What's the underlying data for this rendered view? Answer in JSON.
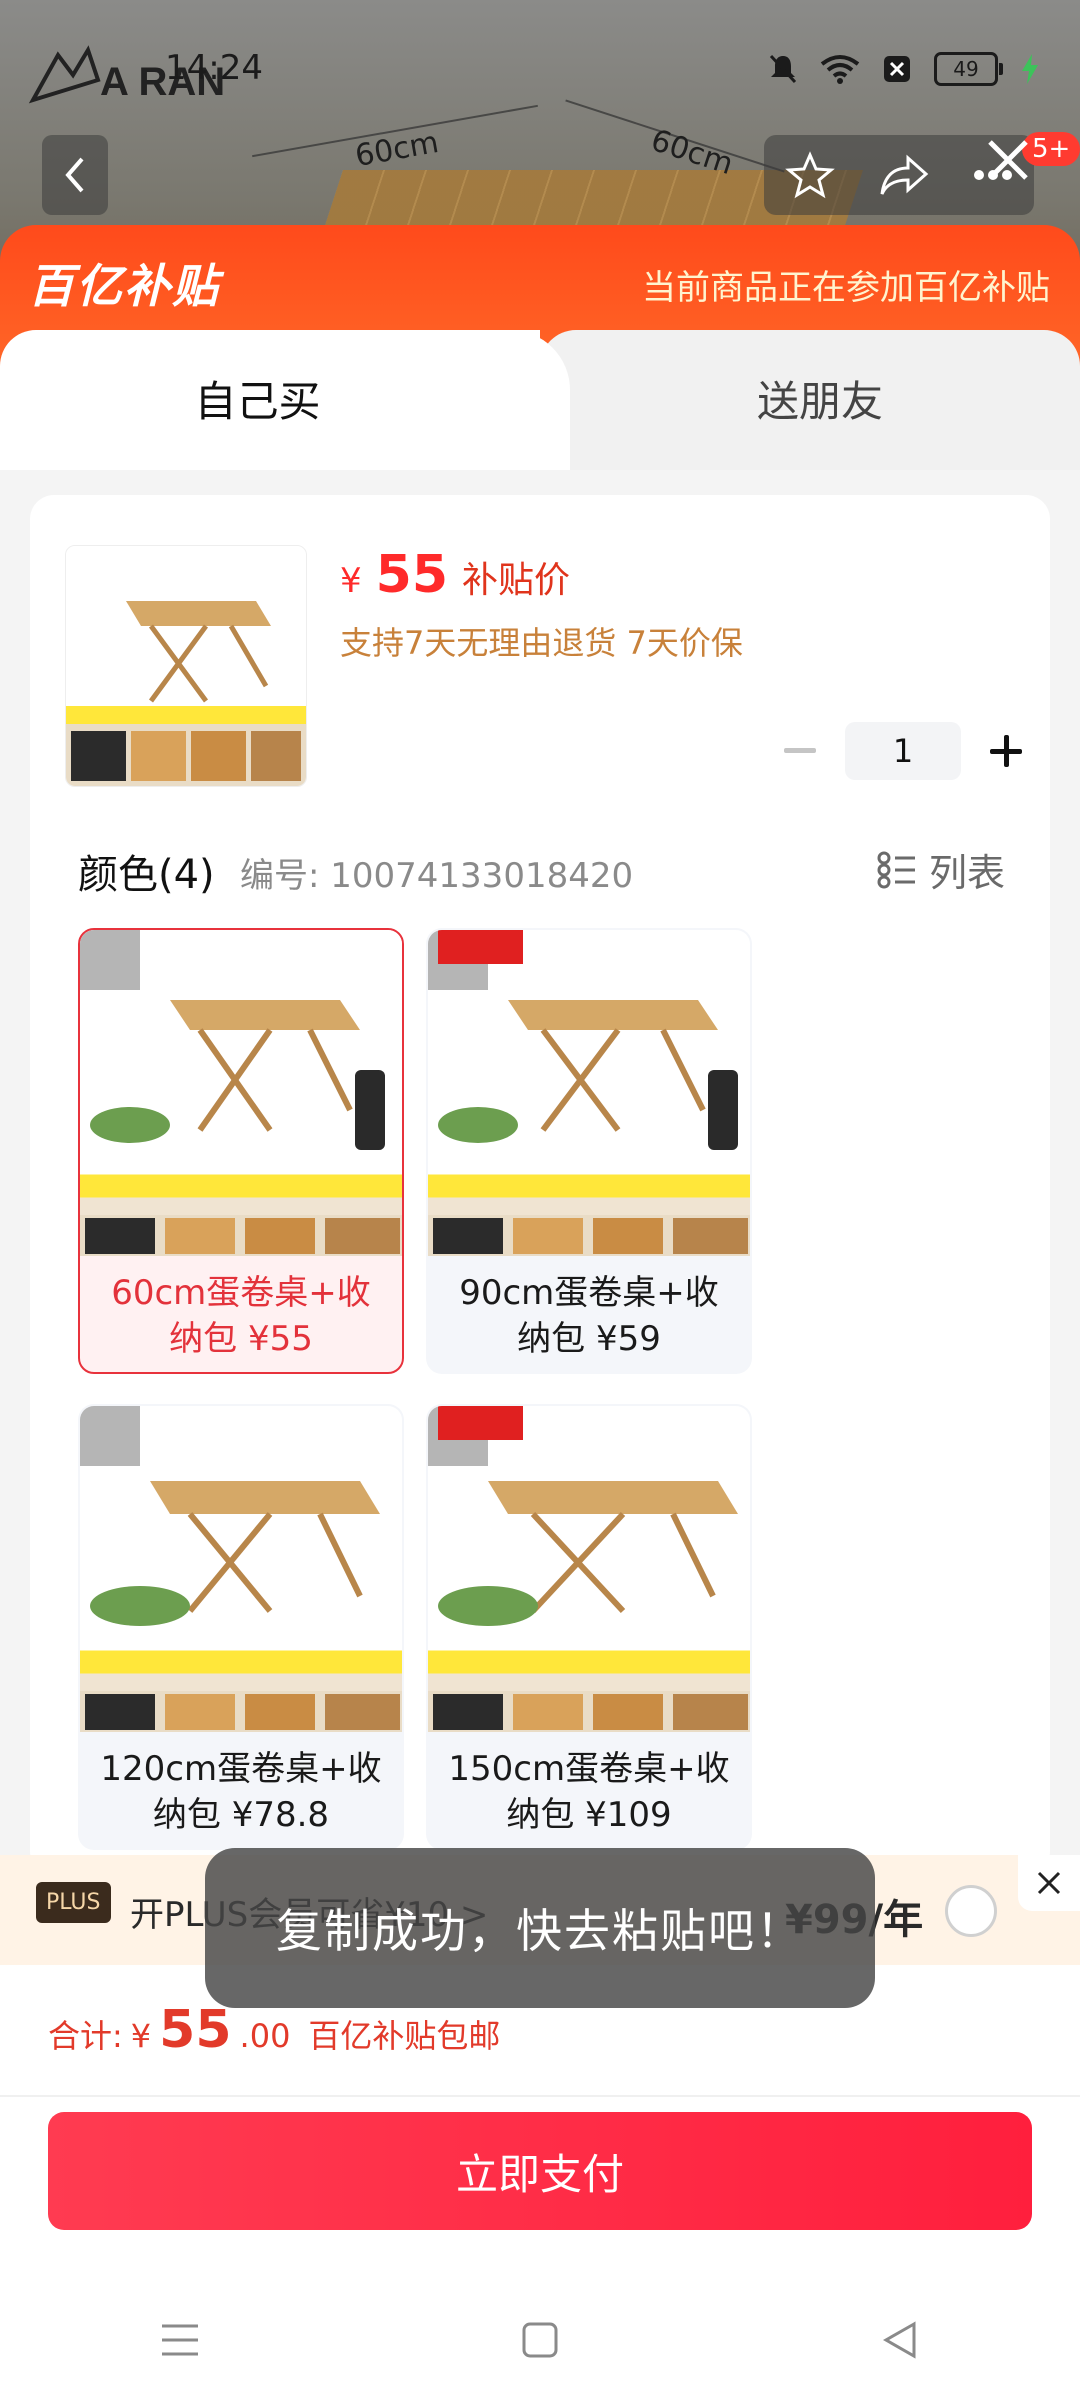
{
  "status_bar": {
    "time": "14:24",
    "battery": "49",
    "brand": "A RAN"
  },
  "background": {
    "dim_left": "60cm",
    "dim_right": "60cm",
    "cart_badge": "5+"
  },
  "promo": {
    "logo_text": "百亿补贴",
    "note": "当前商品正在参加百亿补贴",
    "tabs": [
      "自己买",
      "送朋友"
    ]
  },
  "product": {
    "price_symbol": "¥",
    "price": "55",
    "price_tag": "补贴价",
    "policy": "支持7天无理由退货 7天价保",
    "quantity": "1"
  },
  "variant_section": {
    "title": "颜色(4)",
    "sku_label": "编号: 10074133018420",
    "view_toggle": "列表"
  },
  "options": [
    {
      "line1": "60cm蛋卷桌+收",
      "line2": "纳包 ¥55",
      "selected": true
    },
    {
      "line1": "90cm蛋卷桌+收",
      "line2": "纳包 ¥59",
      "selected": false
    },
    {
      "line1": "120cm蛋卷桌+收",
      "line2": "纳包 ¥78.8",
      "selected": false
    },
    {
      "line1": "150cm蛋卷桌+收",
      "line2": "纳包 ¥109",
      "selected": false
    }
  ],
  "plus": {
    "badge": "PLUS",
    "text": "开PLUS会员可省¥10 >",
    "price": "¥99/年"
  },
  "toast": "复制成功，快去粘贴吧！",
  "total": {
    "label": "合计:",
    "symbol": "¥",
    "int": "55",
    "dec": ".00",
    "note": "百亿补贴包邮"
  },
  "pay_button": "立即支付",
  "colors": {
    "accent_red": "#ff2a2a",
    "promo_orange": "#ff4a1b",
    "pay_red": "#ff1f3d"
  }
}
